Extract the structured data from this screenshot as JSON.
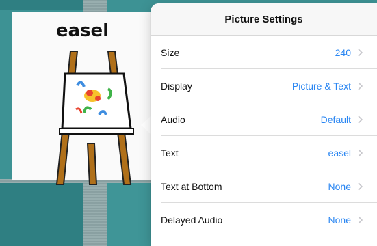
{
  "card": {
    "word": "easel"
  },
  "popover": {
    "title": "Picture Settings",
    "rows": [
      {
        "label": "Size",
        "value": "240"
      },
      {
        "label": "Display",
        "value": "Picture & Text"
      },
      {
        "label": "Audio",
        "value": "Default"
      },
      {
        "label": "Text",
        "value": "easel"
      },
      {
        "label": "Text at Bottom",
        "value": "None"
      },
      {
        "label": "Delayed Audio",
        "value": "None"
      }
    ]
  },
  "icons": {
    "chevron": "chevron-right-icon",
    "easel": "easel-picture"
  },
  "colors": {
    "accent": "#2a86f2",
    "background": "#3d9294"
  }
}
